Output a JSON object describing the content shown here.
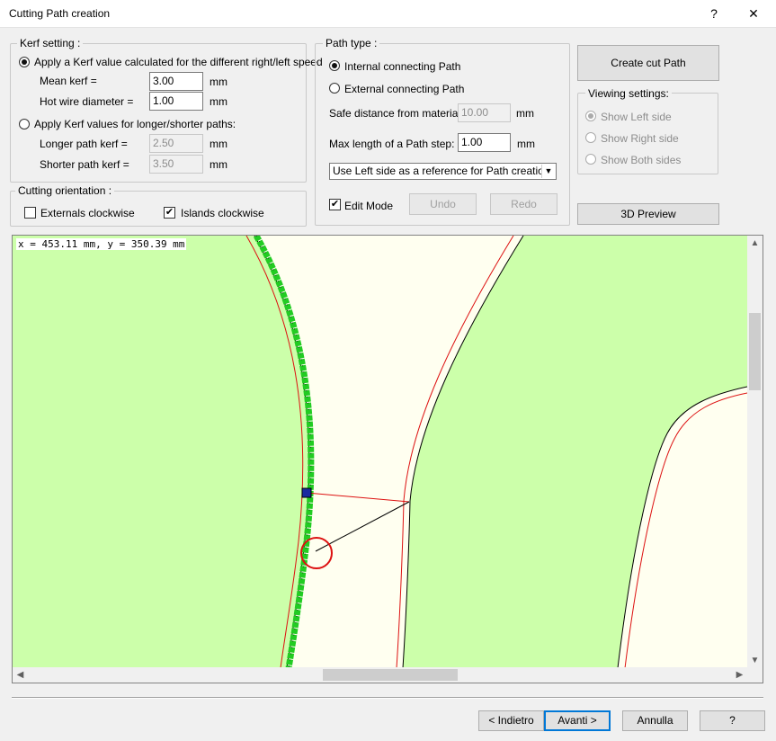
{
  "window": {
    "title": "Cutting Path creation",
    "help_glyph": "?",
    "close_glyph": "✕"
  },
  "kerf": {
    "group_label": "Kerf setting :",
    "option_speed": "Apply a Kerf value calculated for the different right/left speed",
    "mean_kerf_label": "Mean kerf =",
    "mean_kerf_value": "3.00",
    "wire_label": "Hot wire diameter =",
    "wire_value": "1.00",
    "unit": "mm",
    "option_paths": "Apply Kerf values for longer/shorter paths:",
    "longer_label": "Longer path kerf =",
    "longer_value": "2.50",
    "shorter_label": "Shorter path kerf =",
    "shorter_value": "3.50"
  },
  "orientation": {
    "group_label": "Cutting orientation :",
    "externals_label": "Externals clockwise",
    "externals_checked": false,
    "islands_label": "Islands clockwise",
    "islands_checked": true
  },
  "path_type": {
    "group_label": "Path type :",
    "internal_label": "Internal connecting Path",
    "external_label": "External connecting  Path",
    "safe_label": "Safe distance from material :",
    "safe_value": "10.00",
    "max_label": "Max length of a Path step:",
    "max_value": "1.00",
    "unit": "mm",
    "reference_selected": "Use Left side as a reference for Path creation",
    "edit_mode_label": "Edit Mode",
    "edit_mode_checked": true,
    "undo_label": "Undo",
    "redo_label": "Redo"
  },
  "actions": {
    "create_label": "Create cut Path",
    "preview_label": "3D Preview"
  },
  "viewing": {
    "group_label": "Viewing settings:",
    "left_label": "Show Left side",
    "right_label": "Show Right side",
    "both_label": "Show Both sides"
  },
  "canvas": {
    "coords": "x = 453.11 mm, y = 350.39 mm",
    "colors": {
      "material": "#ccffaa",
      "background": "#fffff0",
      "path": "#dd1111",
      "nodes": "#22cc22",
      "selected_node": "#1a2aa0"
    }
  },
  "footer": {
    "back_label": "< Indietro",
    "next_label": "Avanti >",
    "cancel_label": "Annulla",
    "help_label": "?"
  },
  "icons": {
    "scroll_up": "▲",
    "scroll_down": "▼",
    "scroll_left": "◀",
    "scroll_right": "▶",
    "dropdown": "▼",
    "check": "✔"
  }
}
